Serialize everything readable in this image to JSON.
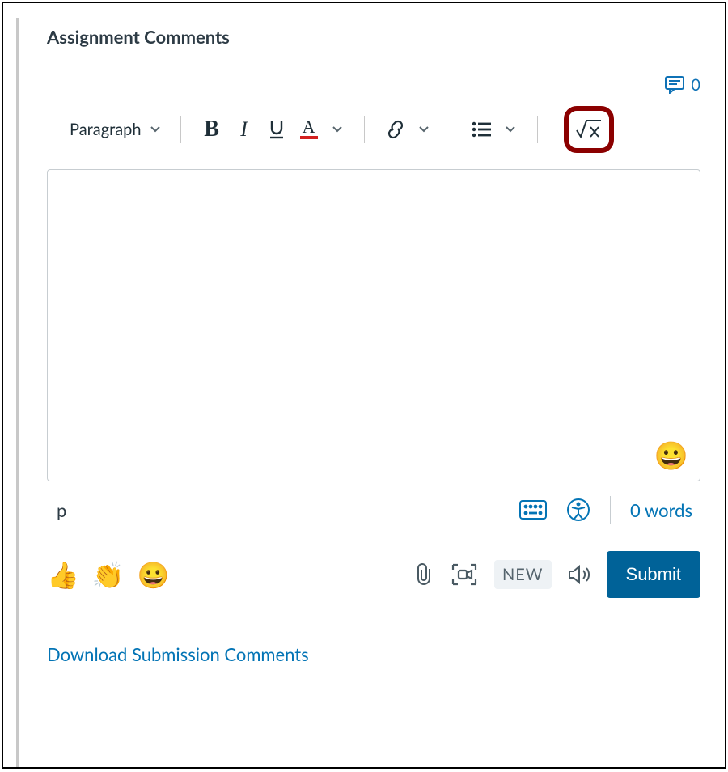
{
  "heading": "Assignment Comments",
  "comment_count": "0",
  "toolbar": {
    "paragraph_label": "Paragraph"
  },
  "editor": {
    "element_path": "p",
    "word_count": "0 words"
  },
  "reactions": [
    "👍",
    "👏",
    "😀"
  ],
  "actions": {
    "new_badge": "NEW",
    "submit_label": "Submit"
  },
  "download_link": "Download Submission Comments"
}
